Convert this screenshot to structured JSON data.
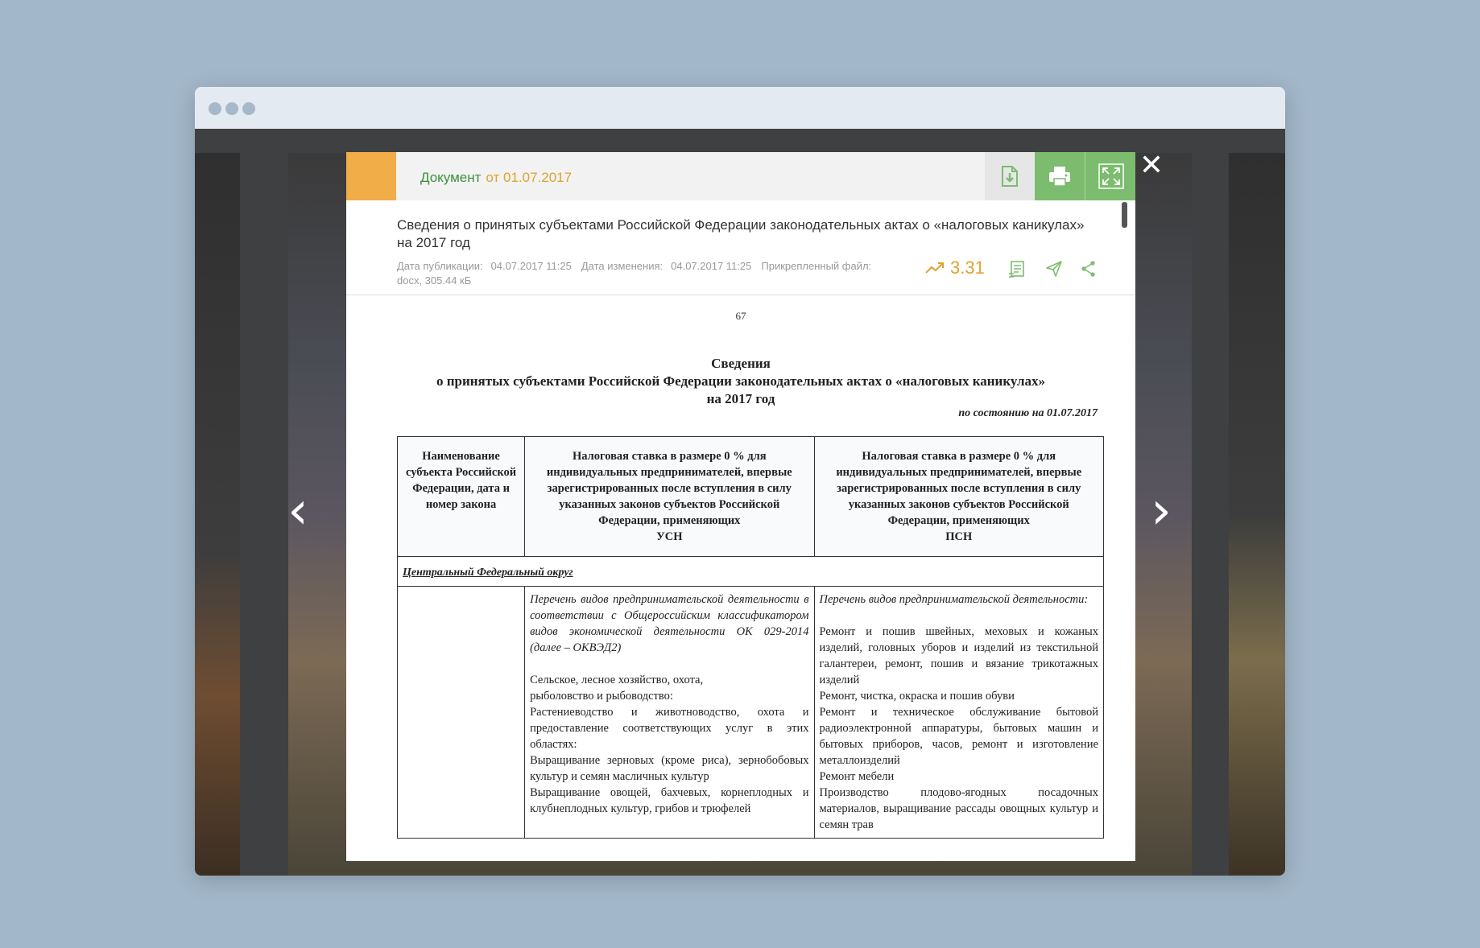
{
  "browser": {
    "dots": [
      "dot-1",
      "dot-2",
      "dot-3"
    ]
  },
  "viewer": {
    "prev_icon": "‹",
    "next_icon": "›",
    "close_icon": "✕"
  },
  "modal": {
    "header": {
      "label": "Документ",
      "date": "от 01.07.2017",
      "buttons": [
        "download-icon",
        "print-icon",
        "expand-icon"
      ]
    },
    "title": "Сведения о принятых субъектами Российской Федерации законодательных актах о «налоговых каникулах» на 2017 год",
    "meta": {
      "published_label": "Дата публикации:",
      "published_value": "04.07.2017 11:25",
      "changed_label": "Дата изменения:",
      "changed_value": "04.07.2017 11:25",
      "attached_label": "Прикрепленный файл:",
      "attached_value": "docx, 305.44 кБ"
    },
    "rating": "3.31",
    "actions": [
      "trend-icon",
      "document-icon",
      "send-icon",
      "share-icon"
    ]
  },
  "document": {
    "page_number": "67",
    "heading_line1": "Сведения",
    "heading_line2": "о принятых субъектами Российской Федерации законодательных актах о «налоговых каникулах»",
    "heading_line3": "на 2017 год",
    "state": "по состоянию на 01.07.2017",
    "table": {
      "col1": "Наименование субъекта Российской Федерации, дата и номер закона",
      "col2_text": "Налоговая ставка в размере 0 % для индивидуальных предпринимателей, впервые зарегистрированных после вступления в силу указанных законов субъектов Российской Федерации, применяющих",
      "col2_tag": "УСН",
      "col3_text": "Налоговая ставка в размере 0 % для индивидуальных предпринимателей, впервые зарегистрированных после вступления в силу указанных законов субъектов Российской Федерации, применяющих",
      "col3_tag": "ПСН",
      "region": "Центральный Федеральный округ",
      "usn_intro": "Перечень видов предпринимательской деятельности в соответствии с Общероссийским классификатором видов экономической деятельности ОК 029-2014 (далее – ОКВЭД2)",
      "usn_items": [
        "Сельское, лесное хозяйство, охота,",
        "рыболовство и рыбоводство:",
        "Растениеводство и животноводство, охота и предоставление соответствующих услуг в этих областях:",
        "Выращивание зерновых (кроме риса), зернобобовых культур и семян масличных культур",
        "Выращивание овощей, бахчевых, корнеплодных и клубнеплодных культур, грибов и трюфелей"
      ],
      "psn_intro": "Перечень видов предпринимательской деятельности:",
      "psn_items": [
        "Ремонт и пошив швейных, меховых и кожаных изделий, головных уборов и изделий из текстильной галантереи, ремонт, пошив и вязание трикотажных изделий",
        "Ремонт, чистка, окраска и пошив обуви",
        "Ремонт и техническое обслуживание бытовой радиоэлектронной аппаратуры, бытовых машин и бытовых приборов, часов, ремонт и изготовление металлоизделий",
        "Ремонт мебели",
        "Производство плодово-ягодных посадочных материалов, выращивание рассады овощных культур и семян трав"
      ]
    }
  }
}
